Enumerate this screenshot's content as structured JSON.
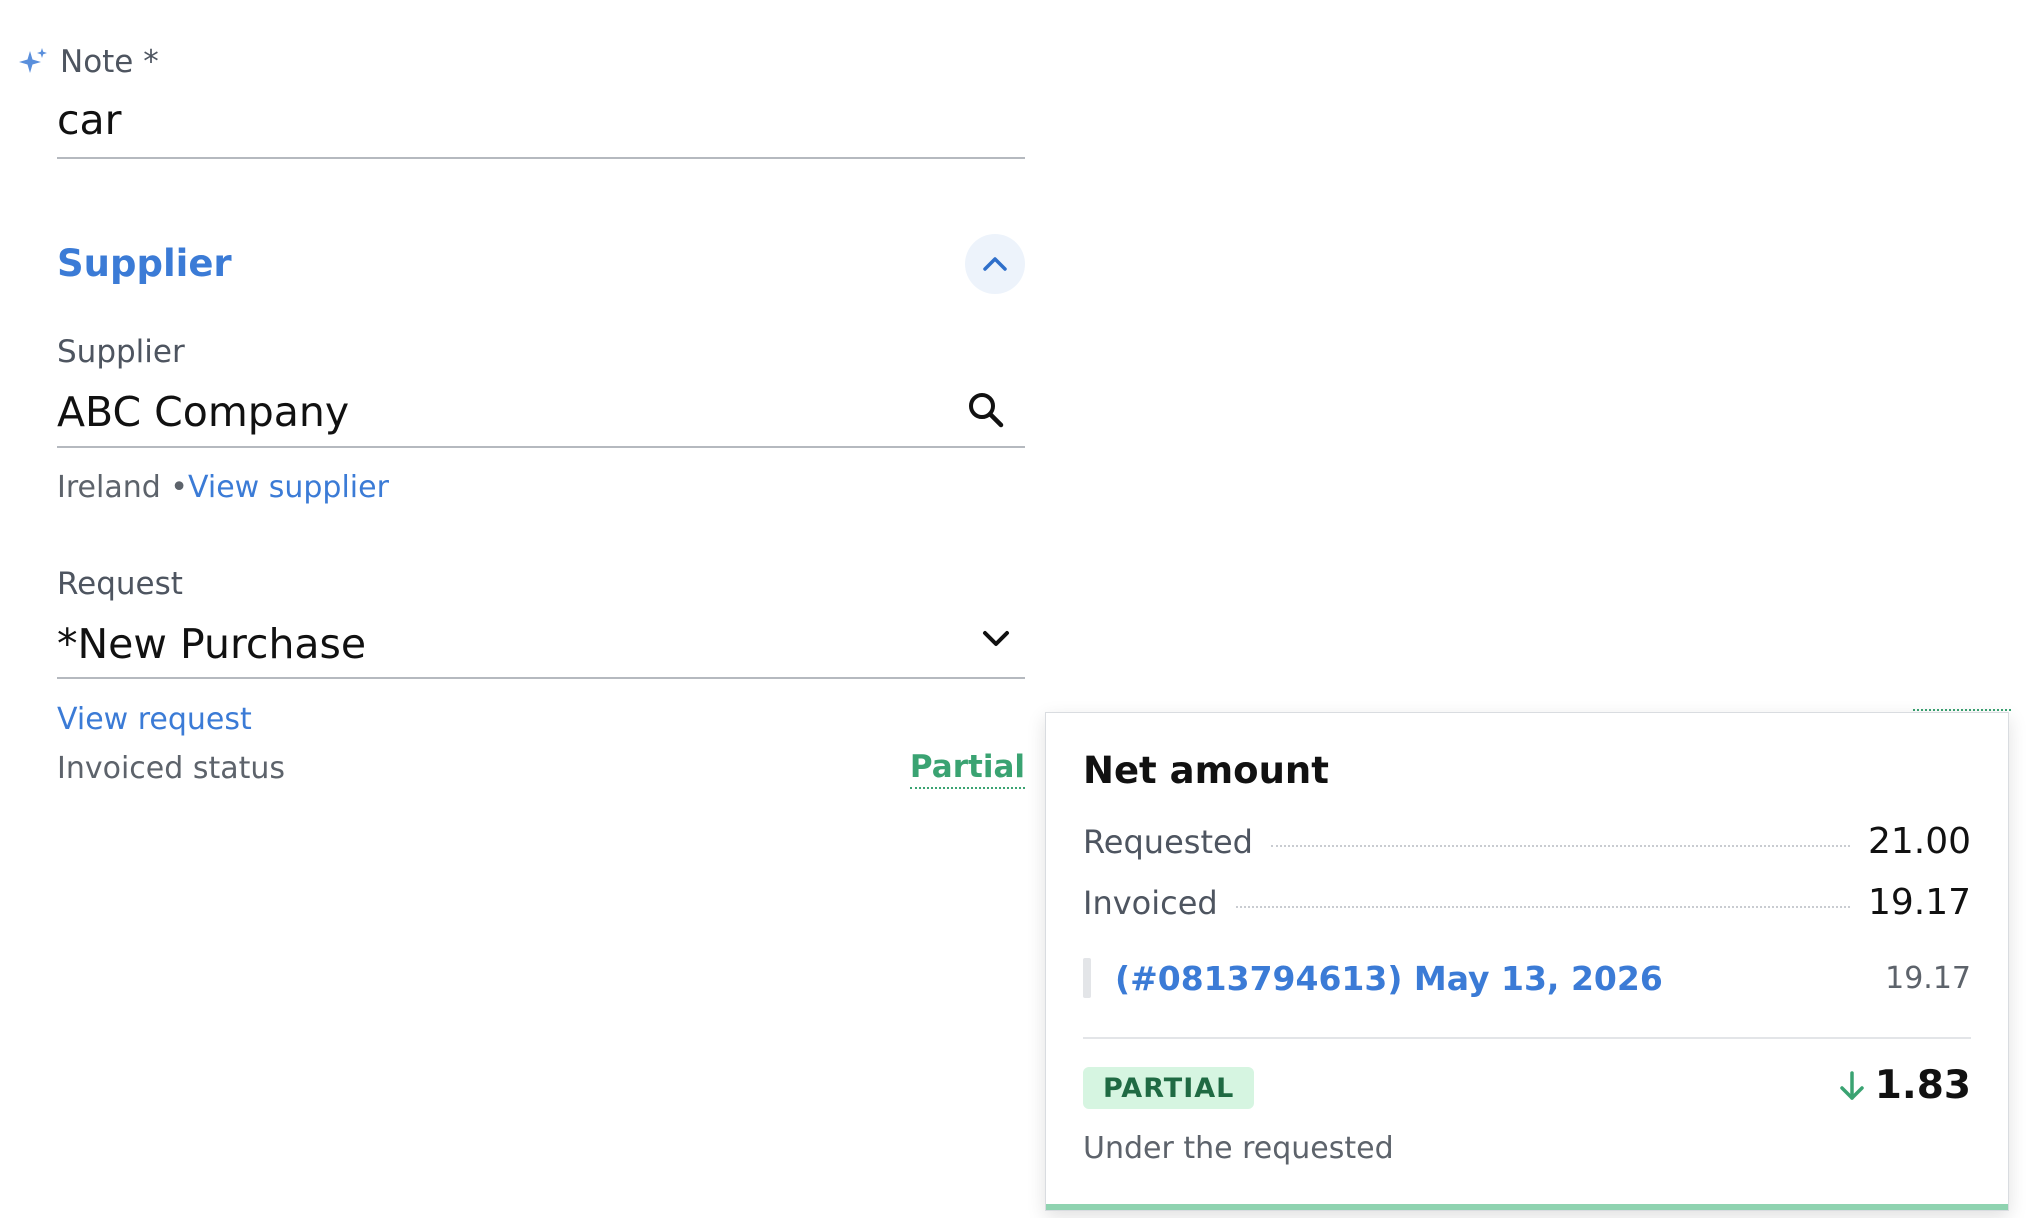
{
  "note": {
    "label": "Note *",
    "value": "car",
    "icon": "sparkle-icon"
  },
  "supplier_section": {
    "title": "Supplier",
    "supplier_label": "Supplier",
    "supplier_value": "ABC Company",
    "country": "Ireland •",
    "view_supplier": "View supplier"
  },
  "request": {
    "label": "Request",
    "value": "*New Purchase",
    "view_request": "View request",
    "invoiced_status_label": "Invoiced status",
    "invoiced_status_value": "Partial"
  },
  "popover": {
    "title": "Net amount",
    "requested_label": "Requested",
    "requested_value": "21.00",
    "invoiced_label": "Invoiced",
    "invoiced_value": "19.17",
    "invoice_link": "(#0813794613) May 13, 2026",
    "invoice_amount": "19.17",
    "badge": "PARTIAL",
    "difference": "1.83",
    "difference_note": "Under the requested"
  },
  "colors": {
    "accent": "#3b7bd6",
    "status_green": "#3aa372",
    "badge_bg": "#d6f5e1"
  }
}
